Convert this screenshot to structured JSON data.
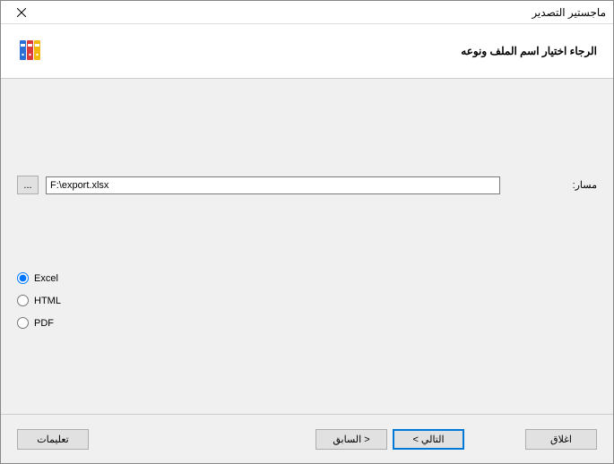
{
  "window": {
    "title": "ماجستير التصدير",
    "close_label": "Close"
  },
  "header": {
    "subtitle": "الرجاء اختيار اسم الملف ونوعه"
  },
  "form": {
    "path_label": "مسار:",
    "path_value": "F:\\export.xlsx",
    "browse_label": "...",
    "formats": {
      "excel": "Excel",
      "html": "HTML",
      "pdf": "PDF"
    },
    "selected_format": "excel"
  },
  "footer": {
    "close": "اغلاق",
    "next": "التالي >",
    "back": "< السابق",
    "help": "تعليمات"
  }
}
